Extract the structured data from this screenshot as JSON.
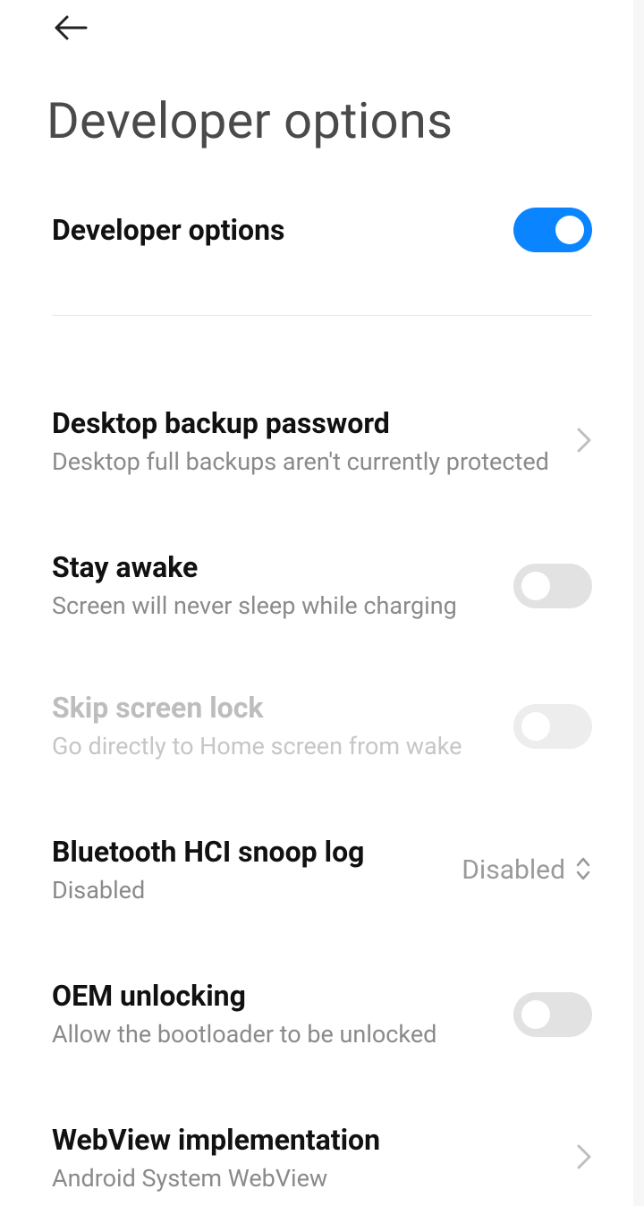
{
  "header": {
    "title": "Developer options"
  },
  "main_toggle": {
    "label": "Developer options"
  },
  "items": {
    "backup": {
      "title": "Desktop backup password",
      "subtitle": "Desktop full backups aren't currently protected"
    },
    "stay_awake": {
      "title": "Stay awake",
      "subtitle": "Screen will never sleep while charging"
    },
    "skip_lock": {
      "title": "Skip screen lock",
      "subtitle": "Go directly to Home screen from wake"
    },
    "bt_snoop": {
      "title": "Bluetooth HCI snoop log",
      "subtitle": "Disabled",
      "value": "Disabled"
    },
    "oem": {
      "title": "OEM unlocking",
      "subtitle": "Allow the bootloader to be unlocked"
    },
    "webview": {
      "title": "WebView implementation",
      "subtitle": "Android System WebView"
    }
  }
}
